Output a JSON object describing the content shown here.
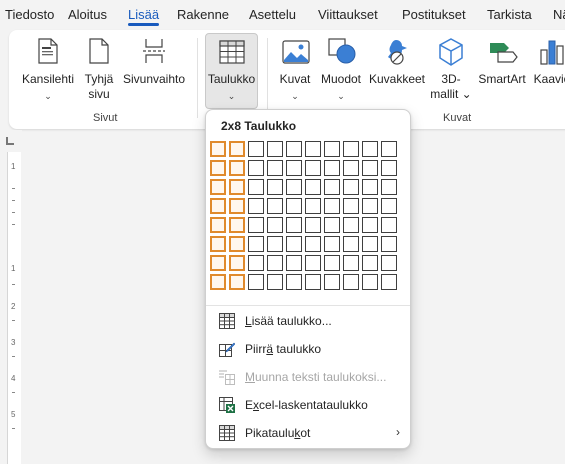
{
  "tabs": [
    {
      "label": "Tiedosto",
      "active": false
    },
    {
      "label": "Aloitus",
      "active": false
    },
    {
      "label": "Lisää",
      "active": true
    },
    {
      "label": "Rakenne",
      "active": false
    },
    {
      "label": "Asettelu",
      "active": false
    },
    {
      "label": "Viittaukset",
      "active": false
    },
    {
      "label": "Postitukset",
      "active": false
    },
    {
      "label": "Tarkista",
      "active": false
    },
    {
      "label": "Nä",
      "active": false
    }
  ],
  "ribbon": {
    "pages": {
      "group_label": "Sivut",
      "cover": {
        "line1": "Kansilehti",
        "chevron": "⌄"
      },
      "blank": {
        "line1": "Tyhjä",
        "line2": "sivu"
      },
      "pagebreak": {
        "line1": "Sivunvaihto"
      }
    },
    "tables": {
      "table": {
        "line1": "Taulukko",
        "chevron": "⌄"
      }
    },
    "illustrations": {
      "group_label": "Kuvat",
      "pictures": {
        "line1": "Kuvat",
        "chevron": "⌄"
      },
      "shapes": {
        "line1": "Muodot",
        "chevron": "⌄"
      },
      "icons": {
        "line1": "Kuvakkeet"
      },
      "models3d": {
        "line1": "3D-",
        "line2": "mallit ⌄"
      },
      "smartart": {
        "line1": "SmartArt"
      },
      "chart": {
        "line1": "Kaavio"
      }
    }
  },
  "table_dropdown": {
    "title": "2x8 Taulukko",
    "grid_columns": 10,
    "grid_rows": 8,
    "selected_columns": 2,
    "selected_rows": 8,
    "items": [
      {
        "pre": "",
        "u": "L",
        "post": "isää taulukko...",
        "icon": "table-insert-icon",
        "disabled": false,
        "submenu": false
      },
      {
        "pre": "Piirr",
        "u": "ä",
        "post": " taulukko",
        "icon": "draw-table-icon",
        "disabled": false,
        "submenu": false
      },
      {
        "pre": "",
        "u": "M",
        "post": "uunna teksti taulukoksi...",
        "icon": "convert-text-to-table-icon",
        "disabled": true,
        "submenu": false
      },
      {
        "pre": "E",
        "u": "x",
        "post": "cel-laskentataulukko",
        "icon": "excel-spreadsheet-icon",
        "disabled": false,
        "submenu": false
      },
      {
        "pre": "Pikataulu",
        "u": "k",
        "post": "ot",
        "icon": "quick-tables-icon",
        "disabled": false,
        "submenu": true
      }
    ],
    "submenu_arrow": "›"
  },
  "ruler": {
    "numbers": [
      "1",
      "1",
      "2",
      "3",
      "4",
      "5"
    ]
  },
  "colors": {
    "accent": "#185abd",
    "selection": "#e08a2c"
  }
}
